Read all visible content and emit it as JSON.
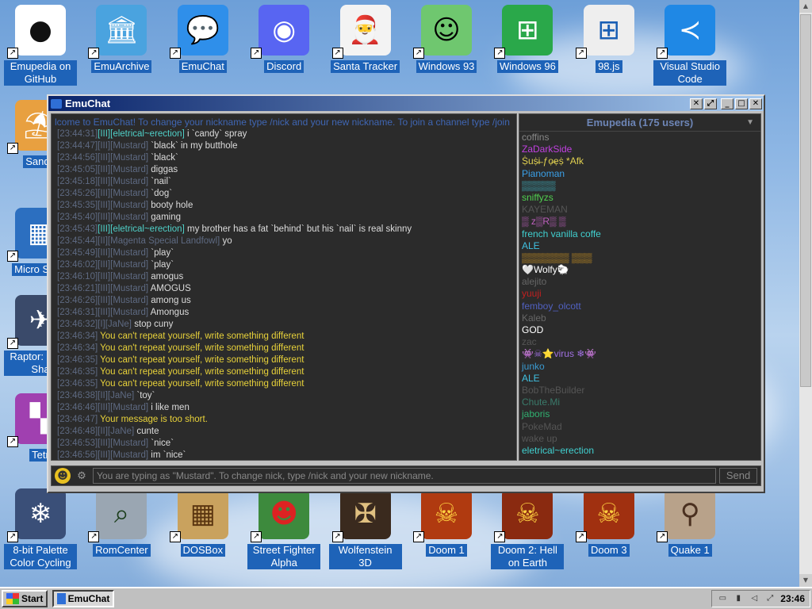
{
  "desktop": {
    "top_row": [
      {
        "label": "Emupedia on GitHub",
        "icon": "github-icon",
        "glyph": "●",
        "bg": "#ffffff",
        "fg": "#111111"
      },
      {
        "label": "EmuArchive",
        "icon": "archive-icon",
        "glyph": "🏛",
        "bg": "#4aa3df",
        "fg": "#ffffff"
      },
      {
        "label": "EmuChat",
        "icon": "chat-icon",
        "glyph": "💬",
        "bg": "#2f8fea",
        "fg": "#ffffff"
      },
      {
        "label": "Discord",
        "icon": "discord-icon",
        "glyph": "◉",
        "bg": "#5865f2",
        "fg": "#ffffff"
      },
      {
        "label": "Santa Tracker",
        "icon": "santa-icon",
        "glyph": "🎅",
        "bg": "#f3f3f3",
        "fg": "#c22"
      },
      {
        "label": "Windows 93",
        "icon": "windows93-icon",
        "glyph": "☺",
        "bg": "#6fc76f",
        "fg": "#000000"
      },
      {
        "label": "Windows 96",
        "icon": "windows96-icon",
        "glyph": "⊞",
        "bg": "#2aa84a",
        "fg": "#ffffff"
      },
      {
        "label": "98.js",
        "icon": "98js-icon",
        "glyph": "⊞",
        "bg": "#eeeeee",
        "fg": "#1a5fb4"
      },
      {
        "label": "Visual Studio Code",
        "icon": "vscode-icon",
        "glyph": "≺",
        "bg": "#1f88e5",
        "fg": "#ffffff"
      }
    ],
    "bottom_row": [
      {
        "label": "8-bit Palette Color Cycling",
        "icon": "palette-icon",
        "glyph": "❄",
        "bg": "#3a4f78",
        "fg": "#ffffff"
      },
      {
        "label": "RomCenter",
        "icon": "romcenter-icon",
        "glyph": "⌕",
        "bg": "#9aa6b2",
        "fg": "#1b3d1b"
      },
      {
        "label": "DOSBox",
        "icon": "dosbox-icon",
        "glyph": "▦",
        "bg": "#c9a25e",
        "fg": "#5a3510"
      },
      {
        "label": "Street Fighter Alpha",
        "icon": "streetfighter-icon",
        "glyph": "☻",
        "bg": "#3d8a3d",
        "fg": "#d22"
      },
      {
        "label": "Wolfenstein 3D",
        "icon": "wolfenstein-icon",
        "glyph": "✠",
        "bg": "#3a2a1e",
        "fg": "#e0c080"
      },
      {
        "label": "Doom 1",
        "icon": "doom1-icon",
        "glyph": "☠",
        "bg": "#b03a10",
        "fg": "#ffd040"
      },
      {
        "label": "Doom 2: Hell on Earth",
        "icon": "doom2-icon",
        "glyph": "☠",
        "bg": "#8a2a10",
        "fg": "#ffd040"
      },
      {
        "label": "Doom 3",
        "icon": "doom3-icon",
        "glyph": "☠",
        "bg": "#a03010",
        "fg": "#ffd040"
      },
      {
        "label": "Quake 1",
        "icon": "quake-icon",
        "glyph": "⚲",
        "bg": "#b8a28a",
        "fg": "#4a3020"
      }
    ],
    "left_partial": [
      {
        "label": "Sandb",
        "icon": "sandbox-icon",
        "glyph": "⛱",
        "bg": "#e8a040"
      },
      {
        "label": "Micro Sudo",
        "icon": "sudoku-icon",
        "glyph": "▦",
        "bg": "#2c6fc0"
      },
      {
        "label": "Raptor: C the Sha",
        "icon": "raptor-icon",
        "glyph": "✈",
        "bg": "#3a4a6a"
      },
      {
        "label": "Tetr",
        "icon": "tetris-icon",
        "glyph": "▚",
        "bg": "#a040b0"
      }
    ]
  },
  "window": {
    "title": "EmuChat",
    "banner": "lcome to EmuChat! To change your nickname type /nick and your new nickname. To join a channel type /join",
    "messages": [
      {
        "ts": "[23:44:31]",
        "nick": "[III][eletrical~erection]",
        "text": "i `candy` spray",
        "kind": "e"
      },
      {
        "ts": "[23:44:47]",
        "nick": "[III][Mustard]",
        "text": "`black` in my butthole",
        "kind": "n"
      },
      {
        "ts": "[23:44:56]",
        "nick": "[III][Mustard]",
        "text": "`black`",
        "kind": "n"
      },
      {
        "ts": "[23:45:05]",
        "nick": "[III][Mustard]",
        "text": "diggas",
        "kind": "n"
      },
      {
        "ts": "[23:45:18]",
        "nick": "[III][Mustard]",
        "text": "`nail`",
        "kind": "n"
      },
      {
        "ts": "[23:45:26]",
        "nick": "[III][Mustard]",
        "text": "`dog`",
        "kind": "n"
      },
      {
        "ts": "[23:45:35]",
        "nick": "[III][Mustard]",
        "text": "booty hole",
        "kind": "n"
      },
      {
        "ts": "[23:45:40]",
        "nick": "[III][Mustard]",
        "text": "gaming",
        "kind": "n"
      },
      {
        "ts": "[23:45:43]",
        "nick": "[III][eletrical~erection]",
        "text": "my brother has a fat `behind` but his `nail` is real skinny",
        "kind": "e"
      },
      {
        "ts": "[23:45:44]",
        "nick": "[II][Magenta Special Landfowl]",
        "text": "yo",
        "kind": "n"
      },
      {
        "ts": "[23:45:49]",
        "nick": "[III][Mustard]",
        "text": "`play`",
        "kind": "n"
      },
      {
        "ts": "[23:46:02]",
        "nick": "[III][Mustard]",
        "text": "`play`",
        "kind": "n"
      },
      {
        "ts": "[23:46:10]",
        "nick": "[III][Mustard]",
        "text": "amogus",
        "kind": "n"
      },
      {
        "ts": "[23:46:21]",
        "nick": "[III][Mustard]",
        "text": "AMOGUS",
        "kind": "n"
      },
      {
        "ts": "[23:46:26]",
        "nick": "[III][Mustard]",
        "text": "among us",
        "kind": "n"
      },
      {
        "ts": "[23:46:31]",
        "nick": "[III][Mustard]",
        "text": "Amongus",
        "kind": "n"
      },
      {
        "ts": "[23:46:32]",
        "nick": "[I][JaNe]",
        "text": "stop cuny",
        "kind": "n"
      },
      {
        "ts": "[23:46:34]",
        "nick": "",
        "text": "You can't repeat yourself, write something different",
        "kind": "sys"
      },
      {
        "ts": "[23:46:34]",
        "nick": "",
        "text": "You can't repeat yourself, write something different",
        "kind": "sys"
      },
      {
        "ts": "[23:46:35]",
        "nick": "",
        "text": "You can't repeat yourself, write something different",
        "kind": "sys"
      },
      {
        "ts": "[23:46:35]",
        "nick": "",
        "text": "You can't repeat yourself, write something different",
        "kind": "sys"
      },
      {
        "ts": "[23:46:35]",
        "nick": "",
        "text": "You can't repeat yourself, write something different",
        "kind": "sys"
      },
      {
        "ts": "[23:46:38]",
        "nick": "[II][JaNe]",
        "text": "`toy`",
        "kind": "n"
      },
      {
        "ts": "[23:46:46]",
        "nick": "[III][Mustard]",
        "text": "i like men",
        "kind": "n"
      },
      {
        "ts": "[23:46:47]",
        "nick": "",
        "text": "Your message is too short.",
        "kind": "sys"
      },
      {
        "ts": "[23:46:48]",
        "nick": "[II][JaNe]",
        "text": "cunte",
        "kind": "n"
      },
      {
        "ts": "[23:46:53]",
        "nick": "[III][Mustard]",
        "text": "`nice`",
        "kind": "n"
      },
      {
        "ts": "[23:46:56]",
        "nick": "[III][Mustard]",
        "text": "im `nice`",
        "kind": "n"
      }
    ],
    "users_header": "Emupedia (175 users)",
    "users": [
      {
        "name": "coffins",
        "color": "#888888"
      },
      {
        "name": "ZaDarkSide",
        "color": "#c040e0"
      },
      {
        "name": "Ṩuṩi̶ ƒọ̶ẹṩ *Afk",
        "color": "#e0d050"
      },
      {
        "name": "Pianoman",
        "color": "#3aa0e8"
      },
      {
        "name": "▒▒▒▒▒",
        "color": "#40c0d0"
      },
      {
        "name": "sniffyzs",
        "color": "#50d050"
      },
      {
        "name": "KAYEMAN",
        "color": "#555555"
      },
      {
        "name": "▒ z▒R▒ ▒",
        "color": "#c060c0"
      },
      {
        "name": "french vanilla coffe",
        "color": "#40d0d0"
      },
      {
        "name": "ALE",
        "color": "#40c0e0"
      },
      {
        "name": "▒▒▒▒▒▒▒ ▒▒▒",
        "color": "#e0a020"
      },
      {
        "name": "🤍Wolfy🐑",
        "color": "#ffffff"
      },
      {
        "name": "alejito",
        "color": "#666666"
      },
      {
        "name": "yuuji",
        "color": "#c02020"
      },
      {
        "name": "femboy_olcott",
        "color": "#5060c0"
      },
      {
        "name": "Kaleb",
        "color": "#666666"
      },
      {
        "name": "GOD",
        "color": "#ffffff"
      },
      {
        "name": "zac",
        "color": "#555555"
      },
      {
        "name": "👾☠⭐virus ❄👾",
        "color": "#a070e0"
      },
      {
        "name": "junko",
        "color": "#3a9ad0"
      },
      {
        "name": "ALE",
        "color": "#40c0e0"
      },
      {
        "name": "BobTheBuilder",
        "color": "#555555"
      },
      {
        "name": "Chute.Mi",
        "color": "#3a7a6a"
      },
      {
        "name": "jaboris",
        "color": "#30b070"
      },
      {
        "name": "PokeMad",
        "color": "#555555"
      },
      {
        "name": "wake up",
        "color": "#555555"
      },
      {
        "name": "eletrical~erection",
        "color": "#40d0d0"
      }
    ],
    "input_placeholder": "You are typing as \"Mustard\". To change nick, type /nick and your new nickname.",
    "send_label": "Send"
  },
  "taskbar": {
    "start_label": "Start",
    "task_label": "EmuChat",
    "clock": "23:46"
  }
}
